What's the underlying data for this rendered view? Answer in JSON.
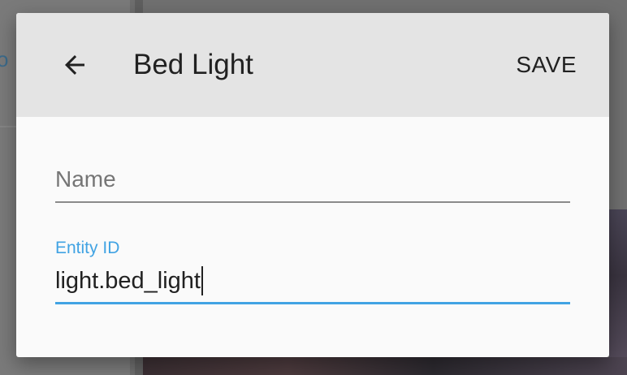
{
  "background": {
    "left_partial_text": "o"
  },
  "dialog": {
    "title": "Bed Light",
    "back_icon": "arrow-left-icon",
    "save_label": "SAVE",
    "name_field": {
      "placeholder": "Name",
      "value": ""
    },
    "entity_field": {
      "label": "Entity ID",
      "value": "light.bed_light"
    }
  },
  "colors": {
    "header_bg": "#e4e4e4",
    "dialog_bg": "#fafafa",
    "accent": "#41a3e3",
    "text": "#212121",
    "placeholder": "#757575"
  }
}
